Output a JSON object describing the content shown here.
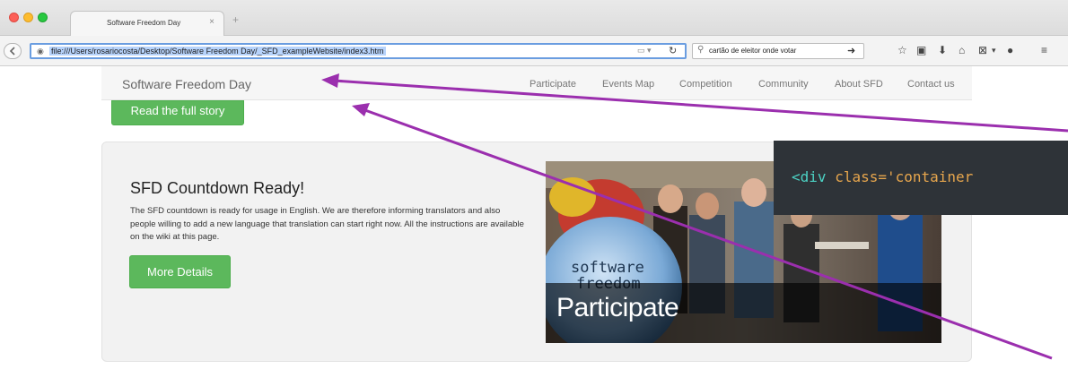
{
  "browser": {
    "tab_title": "Software Freedom Day",
    "tab_close": "×",
    "new_tab": "+",
    "url": "file:///Users/rosariocosta/Desktop/Software Freedom Day/_SFD_exampleWebsite/index3.htm",
    "search_text": "cartão de eleitor onde votar"
  },
  "page": {
    "brand": "Software Freedom Day",
    "nav": [
      "Participate",
      "Events Map",
      "Competition",
      "Community",
      "About SFD",
      "Contact us"
    ],
    "story_button": "Read the full story",
    "panel": {
      "title": "SFD Countdown Ready!",
      "body": "The SFD countdown is ready for usage in English. We are therefore informing translators and also people willing to add a new language that translation can start right now. All the instructions are available on the wiki at this page.",
      "button": "More Details"
    },
    "photo": {
      "caption": "Participate",
      "banner_text": "software freedom"
    }
  },
  "code_snippet": {
    "open": "<",
    "tag": "div",
    "attr": "class=",
    "value": "'container"
  },
  "colors": {
    "accent_green": "#5cb85c",
    "arrow": "#9b2fae",
    "code_bg": "#2e3338"
  }
}
